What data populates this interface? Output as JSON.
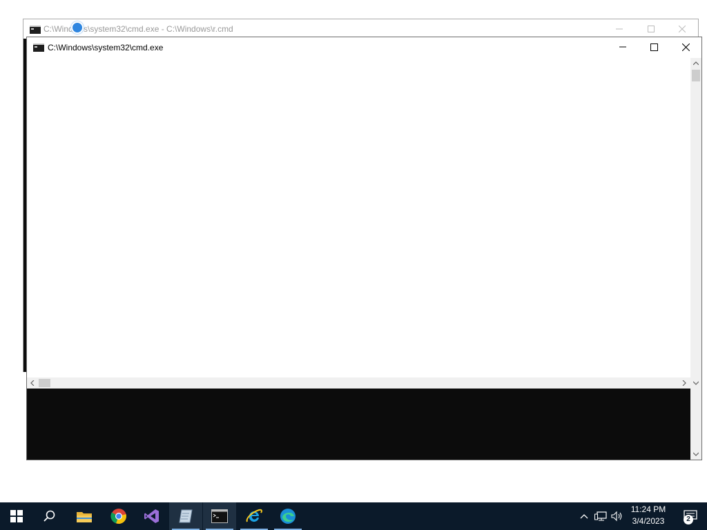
{
  "back_window": {
    "title": "C:\\Windows\\system32\\cmd.exe - C:\\Windows\\r.cmd"
  },
  "front_window": {
    "title": "C:\\Windows\\system32\\cmd.exe"
  },
  "taskbar": {
    "apps": [
      {
        "name": "start",
        "icon": "windows-logo-icon"
      },
      {
        "name": "search",
        "icon": "search-icon"
      },
      {
        "name": "file-explorer",
        "icon": "folder-icon"
      },
      {
        "name": "chrome",
        "icon": "chrome-icon"
      },
      {
        "name": "visual-studio",
        "icon": "visual-studio-icon"
      },
      {
        "name": "notepad-like",
        "icon": "app-icon"
      },
      {
        "name": "command-prompt",
        "icon": "cmd-icon"
      },
      {
        "name": "internet-explorer",
        "icon": "ie-icon"
      },
      {
        "name": "edge",
        "icon": "edge-icon"
      }
    ],
    "clock": {
      "time": "11:24 PM",
      "date": "3/4/2023"
    },
    "notification_count": "2"
  },
  "colors": {
    "taskbar_bg": "#0b1a2a",
    "console_bg": "#0c0c0c",
    "accent": "#7fb2e5"
  }
}
